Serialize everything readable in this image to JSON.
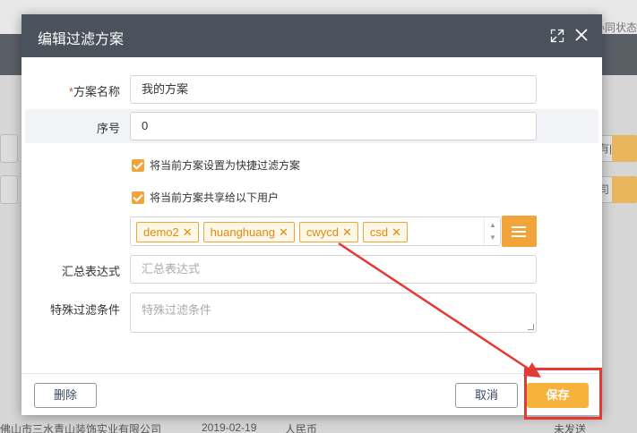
{
  "background": {
    "tab_text": "办同状态",
    "row": {
      "company": "佛山市三水青山装饰实业有限公司",
      "date": "2019-02-19",
      "currency": "人民币",
      "status": "未发送"
    },
    "right_box_1": "有|",
    "right_box_2": "司"
  },
  "dialog": {
    "title": "编辑过滤方案",
    "fields": {
      "name": {
        "required_mark": "*",
        "label": "方案名称",
        "value": "我的方案"
      },
      "seq": {
        "label": "序号",
        "value": "0"
      },
      "summary": {
        "label": "汇总表达式",
        "placeholder": "汇总表达式"
      },
      "special": {
        "label": "特殊过滤条件",
        "placeholder": "特殊过滤条件"
      }
    },
    "checkboxes": {
      "quick": {
        "label": "将当前方案设置为快捷过滤方案",
        "checked": true
      },
      "share": {
        "label": "将当前方案共享给以下用户",
        "checked": true
      }
    },
    "users": [
      "demo2",
      "huanghuang",
      "cwycd",
      "csd"
    ],
    "tag_remove_glyph": "✕",
    "buttons": {
      "delete": "删除",
      "cancel": "取消",
      "save": "保存"
    }
  },
  "colors": {
    "header": "#4a535b",
    "accent": "#f7b23b",
    "annotation": "#e53935"
  }
}
